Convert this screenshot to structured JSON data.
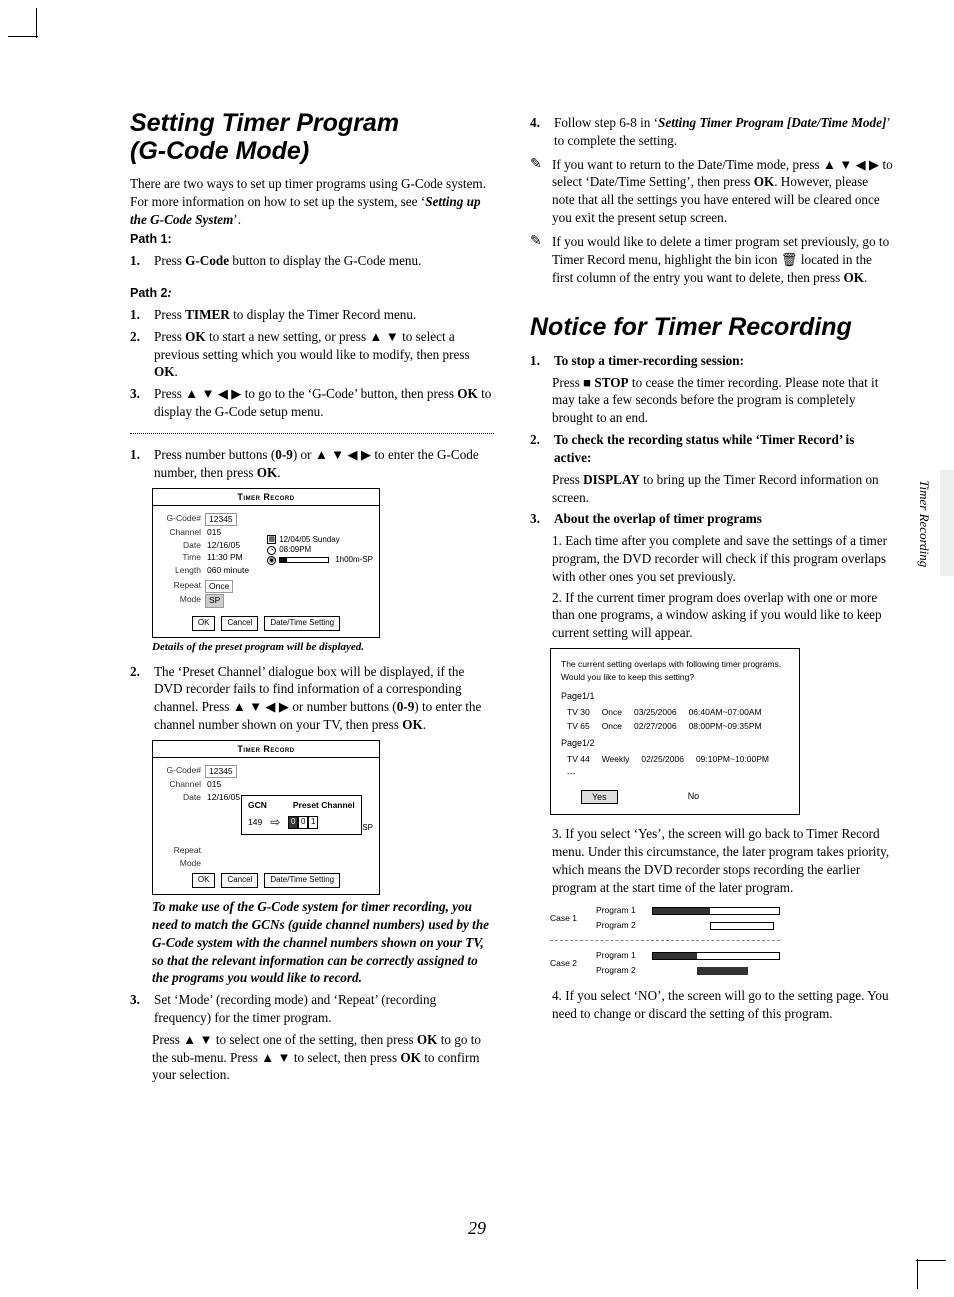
{
  "page_number": "29",
  "side_label": "Timer Recording",
  "left": {
    "heading_l1": "Setting Timer Program",
    "heading_l2": "(G-Code Mode)",
    "intro": "There are two ways to set up timer programs using G-Code system. For more information on how to set up the system, see ‘",
    "intro_bold": "Setting up the G-Code System",
    "intro_after": "’.",
    "path1_label": "Path 1:",
    "p1s1_pre": "Press ",
    "p1s1_bold": "G-Code",
    "p1s1_post": " button to display the G-Code menu.",
    "path2_label": "Path 2",
    "path2_colon": ":",
    "p2s1_pre": "Press ",
    "p2s1_bold": "TIMER",
    "p2s1_post": " to display the Timer Record menu.",
    "p2s2_pre": "Press ",
    "p2s2_bold": "OK",
    "p2s2_mid": " to start a new setting, or press ▲ ▼ to select a previous setting which you would like to modify, then press ",
    "p2s2_bold2": "OK",
    "p2s2_post": ".",
    "p2s3_pre": "Press ▲ ▼ ◀ ▶ to go to the ‘G-Code’ button, then press ",
    "p2s3_bold": "OK",
    "p2s3_post": " to display the G-Code setup menu.",
    "s1_pre": "Press number buttons (",
    "s1_bold1": "0-9",
    "s1_mid": ") or ▲ ▼ ◀ ▶ to enter the G-Code number, then press ",
    "s1_bold2": "OK",
    "s1_post": ".",
    "fig1_caption": "Details of the preset program will be displayed.",
    "s2_pre": "The ‘Preset Channel’ dialogue box will be displayed, if the DVD recorder fails to find information of a corresponding channel. Press ▲ ▼ ◀ ▶ or number buttons (",
    "s2_bold": "0-9",
    "s2_post": ") to enter the channel number shown on your TV, then press ",
    "s2_bold2": "OK",
    "s2_end": ".",
    "note_body": "To make use of the G-Code system for timer recording, you need to match the GCNs (guide channel numbers) used by the G-Code system with the channel numbers shown on your TV, so that the relevant information can be correctly assigned to the programs you would like to record.",
    "s3_a": "Set ‘Mode’ (recording mode) and ‘Repeat’ (recording frequency) for the timer program.",
    "s3_b_pre": "Press ▲ ▼ to select one of the setting, then press ",
    "s3_b_bold": "OK",
    "s3_b_mid": " to go to the sub-menu. Press ▲ ▼ to select, then press ",
    "s3_b_bold2": "OK",
    "s3_b_post": " to confirm your selection."
  },
  "osd": {
    "title": "Timer Record",
    "gcode_lbl": "G-Code#",
    "gcode_val": "12345",
    "chan_lbl": "Channel",
    "chan_val": "015",
    "date_lbl": "Date",
    "date_val": "12/16/05",
    "time_lbl": "Time",
    "time_val": "11:30 PM",
    "len_lbl": "Length",
    "len_val": "060 minute",
    "repeat_lbl": "Repeat",
    "repeat_val": "Once",
    "mode_lbl": "Mode",
    "mode_val": "SP",
    "side_date": "12/04/05  Sunday",
    "side_time": "08:09PM",
    "side_dur": "1h00m-SP",
    "btn_ok": "OK",
    "btn_cancel": "Cancel",
    "btn_dt": "Date/Time Setting",
    "popup_gcn": "GCN",
    "popup_preset": "Preset Channel",
    "popup_num": "149",
    "popup_d0": "0",
    "popup_d1": "0",
    "popup_d2": "1"
  },
  "right": {
    "s4_pre": "Follow step 6-8 in ‘",
    "s4_bold": "Setting Timer Program [Date/Time Mode]",
    "s4_post": "’ to complete the setting.",
    "n1_pre": "If you want to return to the Date/Time mode, press ▲ ▼ ◀ ▶ to select ‘Date/Time Setting’, then press ",
    "n1_bold": "OK",
    "n1_post": ". However, please note that all the settings you have entered will be cleared once you exit the present setup screen.",
    "n2_pre": "If you would like to delete a timer program set previously, go to Timer Record menu, highlight the bin icon ",
    "n2_icon": "🗑",
    "n2_mid": " located in the first column of the entry you want to delete, then press ",
    "n2_bold": "OK",
    "n2_post": ".",
    "heading": "Notice for Timer Recording",
    "t1_h": "To stop a timer-recording session:",
    "t1_pre": "Press ■ ",
    "t1_bold": "STOP",
    "t1_post": " to cease the timer recording. Please note that it may take a few seconds before the program is completely brought to an end.",
    "t2_h": "To check the recording status while ‘Timer Record’ is active:",
    "t2_pre": "Press ",
    "t2_bold": "DISPLAY",
    "t2_post": " to bring up the Timer Record information on screen.",
    "t3_h": "About the overlap of timer programs",
    "t3_1": "1. Each time after you complete and save the settings of a timer program, the DVD recorder will check if this program overlaps with other ones you set previously.",
    "t3_2": "2. If the current timer program does overlap with one or more than one programs, a window asking if you would like to keep current setting will appear.",
    "dlg_l1": "The current setting overlaps with following timer programs.",
    "dlg_l2": "Would you like to keep this setting?",
    "dlg_page1": "Page1/1",
    "dlg_page2": "Page1/2",
    "dlg_r1_a": "TV 30",
    "dlg_r1_b": "Once",
    "dlg_r1_c": "03/25/2006",
    "dlg_r1_d": "06:40AM~07:00AM",
    "dlg_r2_a": "TV 65",
    "dlg_r2_b": "Once",
    "dlg_r2_c": "02/27/2006",
    "dlg_r2_d": "08:00PM~09:35PM",
    "dlg_r3_a": "TV 44",
    "dlg_r3_b": "Weekly",
    "dlg_r3_c": "02/25/2006",
    "dlg_r3_d": "09:10PM~10:00PM",
    "dlg_dash": "---",
    "dlg_yes": "Yes",
    "dlg_no": "No",
    "t3_3": "3. If you select ‘Yes’, the screen will go back to Timer Record menu. Under this circumstance, the later program takes priority, which means the DVD recorder stops recording the earlier program at the start time of the later program.",
    "tl_case1": "Case 1",
    "tl_case2": "Case 2",
    "tl_p1": "Program 1",
    "tl_p2": "Program 2",
    "t3_4": "4. If you select ‘NO’, the screen will go to the setting page. You need to change or discard the setting of this program."
  }
}
